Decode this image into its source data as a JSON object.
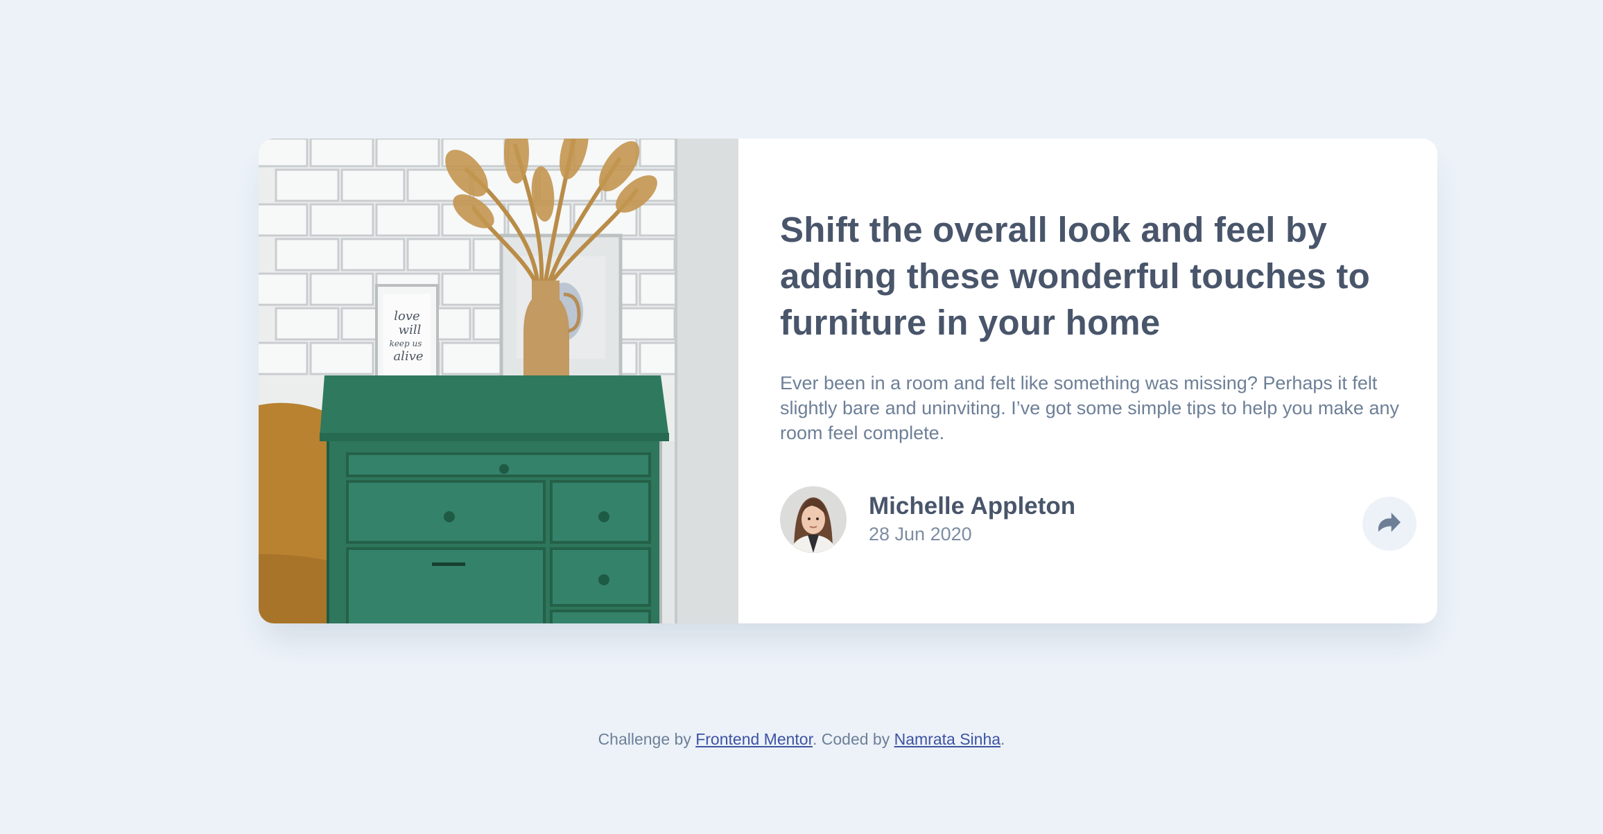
{
  "article": {
    "title": "Shift the overall look and feel by adding these wonderful touches to furniture in your home",
    "description": "Ever been in a room and felt like something was missing? Perhaps it felt slightly bare and uninviting. I’ve got some simple tips to help you make any room feel complete.",
    "image_text": "love will keep us alive"
  },
  "author": {
    "name": "Michelle Appleton",
    "date": "28 Jun 2020"
  },
  "share": {
    "icon": "share-icon"
  },
  "footer": {
    "prefix": "Challenge by ",
    "link1": "Frontend Mentor",
    "middle": ". Coded by ",
    "link2": "Namrata Sinha",
    "suffix": "."
  },
  "colors": {
    "background": "#ecf2f8",
    "title": "#48556a",
    "text": "#6d7f97",
    "link": "#3e52a3",
    "drawer": "#2f7a5f"
  }
}
